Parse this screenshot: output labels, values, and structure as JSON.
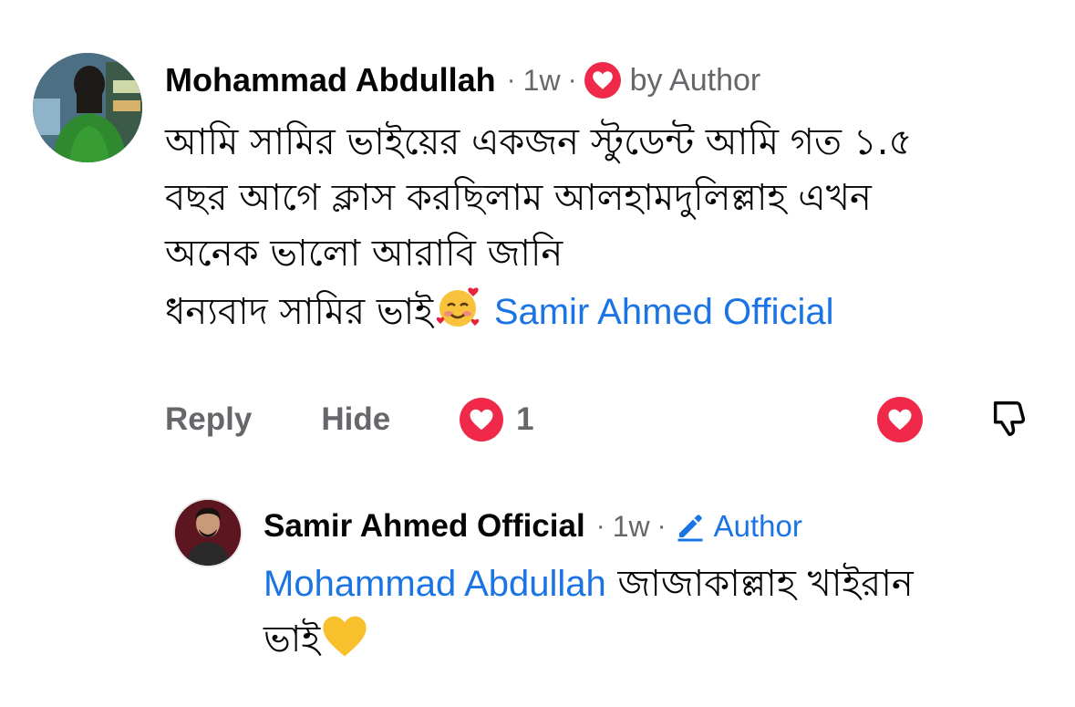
{
  "comment": {
    "author": "Mohammad Abdullah",
    "separator": "·",
    "time": "1w",
    "loved_by": "by Author",
    "body_lines": [
      "আমি সামির ভাইয়ের একজন স্টুডেন্ট আমি গত ১.৫",
      "বছর আগে ক্লাস করছিলাম আলহামদুলিল্লাহ এখন",
      "অনেক ভালো আরাবি জানি",
      "ধন্যবাদ সামির ভাই"
    ],
    "mention": "Samir Ahmed Official",
    "emoji": "smiling-face-with-hearts",
    "actions": {
      "reply": "Reply",
      "hide": "Hide",
      "reaction_count": "1"
    }
  },
  "reply": {
    "author": "Samir Ahmed Official",
    "separator": "·",
    "time": "1w",
    "badge": "Author",
    "mention": "Mohammad Abdullah",
    "text_line1": "জাজাকাল্লাহ খাইরান",
    "text_line2": "ভাই",
    "emoji": "yellow-heart"
  },
  "colors": {
    "heart": "#f02849",
    "link": "#1b74e4",
    "muted": "#65676b",
    "text": "#050505"
  }
}
